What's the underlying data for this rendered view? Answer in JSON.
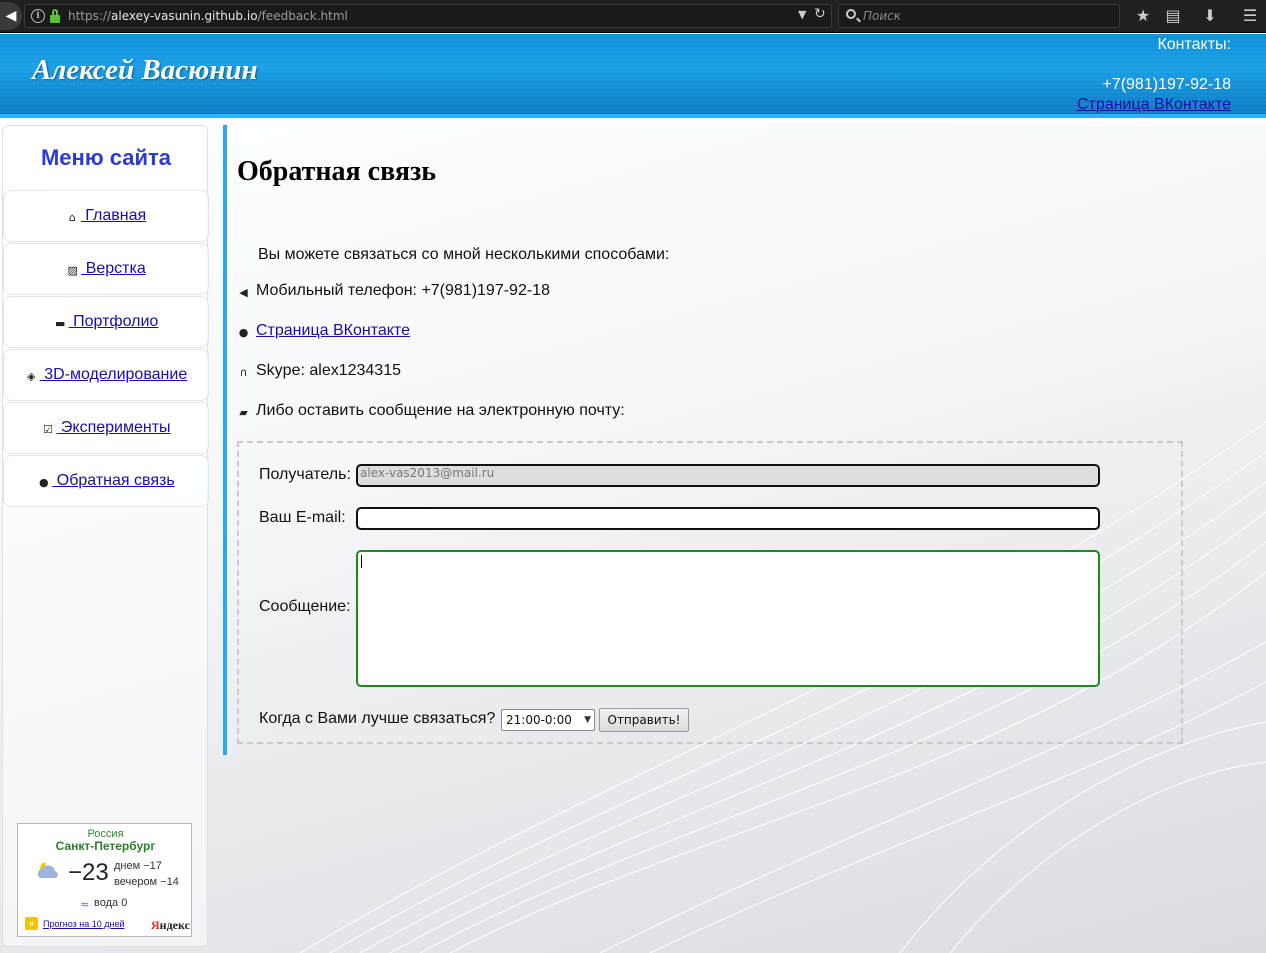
{
  "browser": {
    "url_scheme": "https://",
    "url_host": "alexey-vasunin.github.io",
    "url_path": "/feedback.html",
    "search_placeholder": "Поиск"
  },
  "header": {
    "site_name": "Алексей Васюнин",
    "contacts_title": "Контакты:",
    "contacts_phone": "+7(981)197-92-18",
    "contacts_vk": "Страница ВКонтакте"
  },
  "sidebar": {
    "title": "Меню сайта",
    "items": [
      {
        "label": " Главная",
        "icon": "home-icon"
      },
      {
        "label": " Верстка",
        "icon": "image-icon"
      },
      {
        "label": " Портфолио",
        "icon": "folder-icon"
      },
      {
        "label": " 3D-моделирование",
        "icon": "cube-icon"
      },
      {
        "label": " Эксперименты",
        "icon": "checkbox-icon"
      },
      {
        "label": " Обратная связь",
        "icon": "user-icon"
      }
    ]
  },
  "weather": {
    "country": "Россия",
    "city": "Санкт-Петербург",
    "temperature": "−23",
    "day": "днем −17",
    "evening": "вечером −14",
    "water": "вода 0",
    "forecast_link": "Прогноз на 10 дней",
    "brand_first": "Я",
    "brand_rest": "ндекс"
  },
  "content": {
    "title": "Обратная связь",
    "intro": "Вы можете связаться со мной несколькими способами:",
    "phone_line": "Мобильный телефон: +7(981)197-92-18",
    "vk_link": "Страница ВКонтакте",
    "skype_line": "Skype: alex1234315",
    "email_line": "Либо оставить сообщение на электронную почту:"
  },
  "form": {
    "recipient_label": "Получатель:",
    "recipient_value": "alex-vas2013@mail.ru",
    "email_label": "Ваш E-mail:",
    "email_value": "",
    "message_label": "Сообщение:",
    "when_label": "Когда с Вами лучше связаться?",
    "when_selected": "21:00-0:00",
    "submit_label": "Отправить!"
  },
  "colors": {
    "header_blue": "#1aa0e6",
    "accent_border": "#2ca9ec",
    "menu_title": "#2a3bd6",
    "link": "#1a0dab",
    "textarea_focus": "#1e8a1e"
  }
}
